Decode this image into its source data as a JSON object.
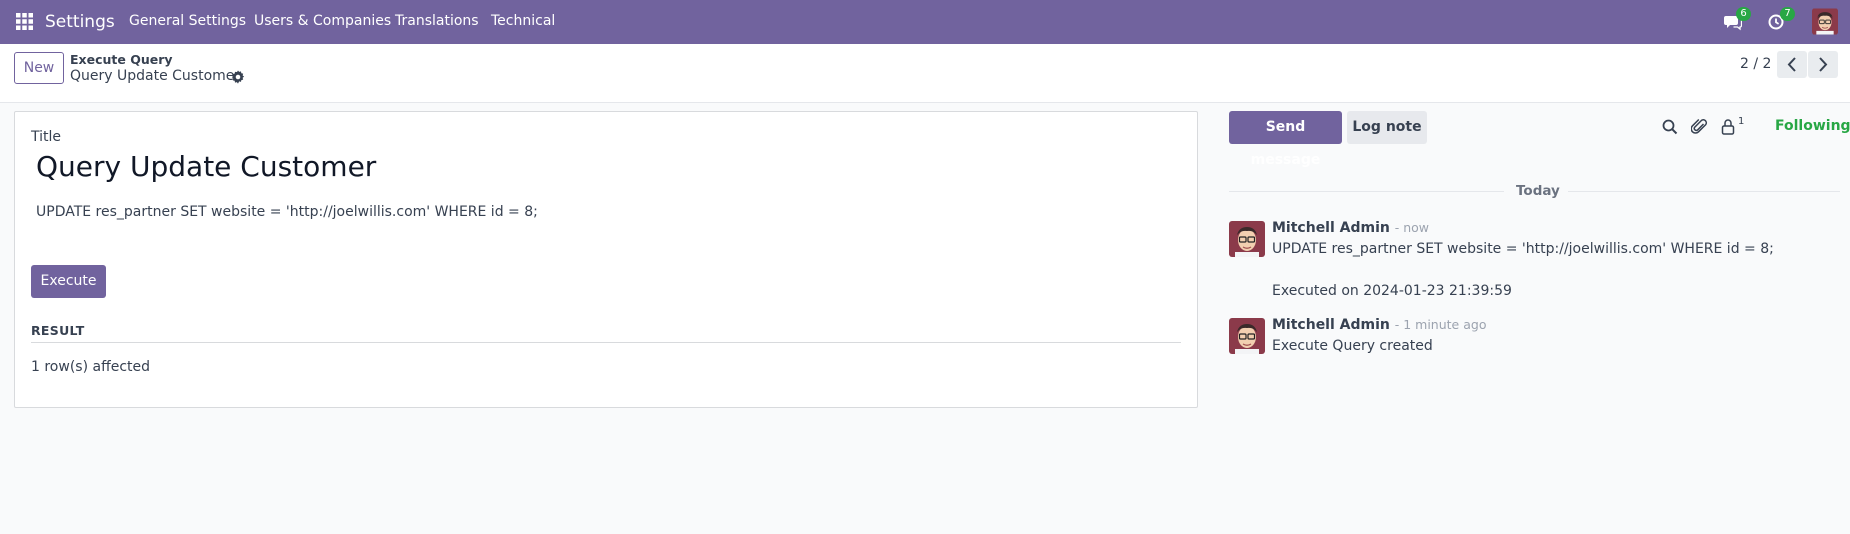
{
  "navbar": {
    "app_name": "Settings",
    "menu": [
      "General Settings",
      "Users & Companies",
      "Translations",
      "Technical"
    ],
    "messages_count": "6",
    "activities_count": "7",
    "background": "#71639e"
  },
  "control_panel": {
    "new_label": "New",
    "breadcrumb_parent": "Execute Query",
    "breadcrumb_current": "Query Update Customer",
    "pager": "2 / 2"
  },
  "form": {
    "title_label": "Title",
    "title_value": "Query Update Customer",
    "query": "UPDATE res_partner SET website = 'http://joelwillis.com' WHERE id = 8;",
    "execute_label": "Execute",
    "result_label": "RESULT",
    "result_value": "1 row(s) affected"
  },
  "chatter": {
    "send_message_label": "Send message",
    "log_note_label": "Log note",
    "followers_count": "1",
    "following_label": "Following",
    "date_separator": "Today",
    "messages": [
      {
        "author": "Mitchell Admin",
        "time": "- now",
        "body_line1": "UPDATE res_partner SET website = 'http://joelwillis.com' WHERE id = 8;",
        "body_line2": "Executed on 2024-01-23 21:39:59"
      },
      {
        "author": "Mitchell Admin",
        "time": "- 1 minute ago",
        "body_line1": "Execute Query created"
      }
    ]
  },
  "colors": {
    "primary": "#71639e",
    "success": "#28a745"
  }
}
